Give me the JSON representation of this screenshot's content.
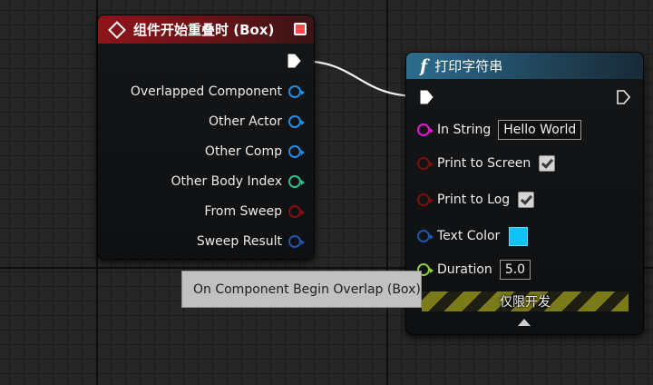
{
  "event_node": {
    "title": "组件开始重叠时 (Box)",
    "icon": "event-diamond-icon",
    "outputs": [
      {
        "label": "Overlapped Component",
        "pin": "object-reference"
      },
      {
        "label": "Other Actor",
        "pin": "object-reference"
      },
      {
        "label": "Other Comp",
        "pin": "object-reference"
      },
      {
        "label": "Other Body Index",
        "pin": "integer"
      },
      {
        "label": "From Sweep",
        "pin": "boolean"
      },
      {
        "label": "Sweep Result",
        "pin": "struct"
      }
    ]
  },
  "print_node": {
    "title": "打印字符串",
    "icon": "function-f-icon",
    "in_string": {
      "label": "In String",
      "value": "Hello World"
    },
    "print_to_screen": {
      "label": "Print to Screen",
      "checked": true
    },
    "print_to_log": {
      "label": "Print to Log",
      "checked": true
    },
    "text_color": {
      "label": "Text Color",
      "value": "#0EC2F5"
    },
    "duration": {
      "label": "Duration",
      "value": "5.0"
    },
    "dev_only_label": "仅限开发"
  },
  "tooltip": {
    "text": "On Component Begin Overlap (Box)"
  },
  "colors": {
    "event_header": "#8e1419",
    "function_header": "#2d6c8c",
    "object_pin": "#1e8ee6",
    "integer_pin": "#2fc38a",
    "boolean_pin": "#8c0c10",
    "string_pin": "#e21ad6",
    "float_pin": "#8ccf3a"
  }
}
